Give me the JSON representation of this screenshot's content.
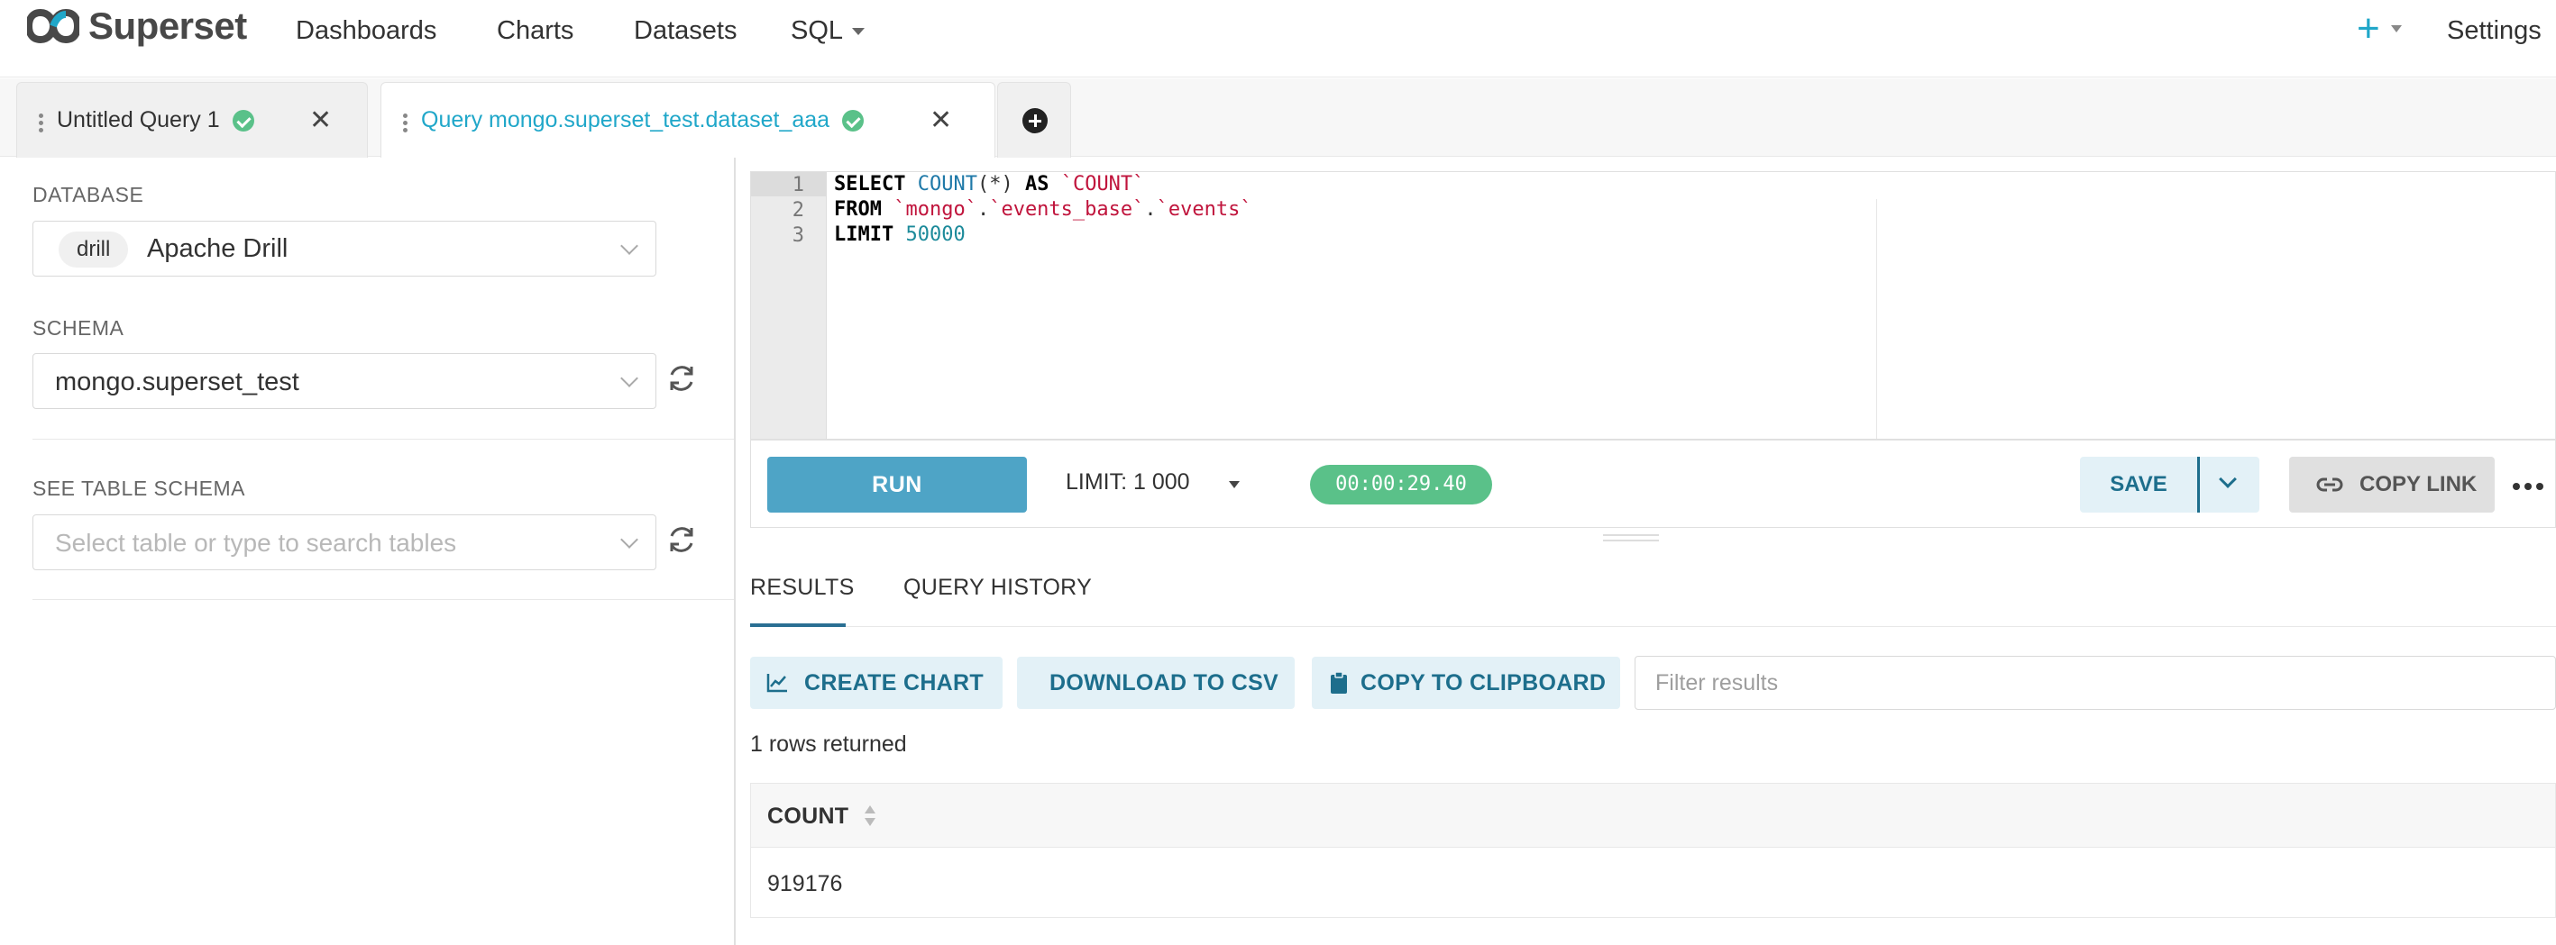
{
  "navbar": {
    "brand": "Superset",
    "items": [
      "Dashboards",
      "Charts",
      "Datasets",
      "SQL"
    ],
    "plus": "+",
    "settings": "Settings"
  },
  "tabs": [
    {
      "label": "Untitled Query 1"
    },
    {
      "label": "Query mongo.superset_test.dataset_aaa"
    }
  ],
  "left_panel": {
    "database_label": "DATABASE",
    "database_tag": "drill",
    "database_value": "Apache Drill",
    "schema_label": "SCHEMA",
    "schema_value": "mongo.superset_test",
    "table_schema_label": "SEE TABLE SCHEMA",
    "table_placeholder": "Select table or type to search tables"
  },
  "editor": {
    "line_numbers": [
      "1",
      "2",
      "3"
    ],
    "lines": [
      {
        "kw1": "SELECT",
        "fn": "COUNT",
        "rest": "(*) ",
        "kw2": "AS",
        "str": "`COUNT`"
      },
      {
        "kw1": "FROM",
        "str1": "`mongo`",
        "dot1": ".",
        "str2": "`events_base`",
        "dot2": ".",
        "str3": "`events`"
      },
      {
        "kw1": "LIMIT",
        "num": "50000"
      }
    ]
  },
  "toolbar": {
    "run": "RUN",
    "limit": "LIMIT:  1 000",
    "timer": "00:00:29.40",
    "save": "SAVE",
    "copy_link": "COPY LINK"
  },
  "results": {
    "tabs": [
      "RESULTS",
      "QUERY HISTORY"
    ],
    "create_chart": "CREATE CHART",
    "download_csv": "DOWNLOAD TO CSV",
    "copy_clipboard": "COPY TO CLIPBOARD",
    "filter_placeholder": "Filter results",
    "rows_returned": "1 rows returned",
    "columns": [
      "COUNT"
    ],
    "rows": [
      [
        "919176"
      ]
    ]
  },
  "colors": {
    "accent": "#20a7c9",
    "run_button": "#4ea4c6",
    "success": "#5ac189",
    "secondary_button_bg": "#e3f1f7",
    "secondary_button_text": "#1d6e8c"
  }
}
